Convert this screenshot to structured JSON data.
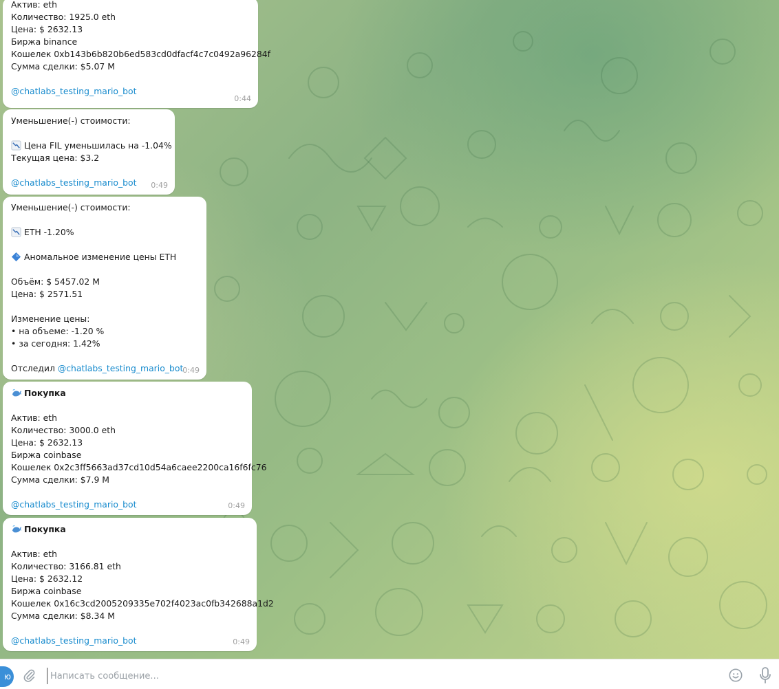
{
  "messages": [
    {
      "lines": [
        "Актив: eth",
        "Количество: 1925.0 eth",
        "Цена: $ 2632.13",
        "Биржа binance",
        "Кошелек 0xb143b6b820b6ed583cd0dfacf4c7c0492a96284f",
        "Сумма сделки: $5.07 M"
      ],
      "link": "@chatlabs_testing_mario_bot",
      "time": "0:44"
    },
    {
      "header": "Уменьшение(-) стоимости:",
      "alert_text": "Цена FIL уменьшилась на -1.04%",
      "line2": "Текущая цена: $3.2",
      "link": "@chatlabs_testing_mario_bot",
      "time": "0:49"
    },
    {
      "header": "Уменьшение(-) стоимости:",
      "alert_text": "ETH -1.20%",
      "anomaly": "Аномальное изменение цены ETH",
      "volume": "Объём: $ 5457.02 M",
      "price": "Цена: $ 2571.51",
      "change_header": "Изменение цены:",
      "change_volume": " • на объеме: -1.20 %",
      "change_today": " • за сегодня: 1.42%",
      "tracked_prefix": "Отследил ",
      "link": "@chatlabs_testing_mario_bot",
      "time": "0:49"
    },
    {
      "title": "Покупка",
      "lines": [
        "Актив: eth",
        "Количество: 3000.0 eth",
        "Цена: $ 2632.13",
        "Биржа coinbase",
        "Кошелек 0x2c3ff5663ad37cd10d54a6caee2200ca16f6fc76",
        "Сумма сделки: $7.9 M"
      ],
      "link": "@chatlabs_testing_mario_bot",
      "time": "0:49"
    },
    {
      "title": "Покупка",
      "lines": [
        "Актив: eth",
        "Количество: 3166.81 eth",
        "Цена: $ 2632.12",
        "Биржа coinbase",
        "Кошелек 0x16c3cd2005209335e702f4023ac0fb342688a1d2",
        "Сумма сделки: $8.34 M"
      ],
      "link": "@chatlabs_testing_mario_bot",
      "time": "0:49"
    }
  ],
  "composer": {
    "placeholder": "Написать сообщение...",
    "send_partial_label": "ю"
  },
  "icons": {
    "chart_down": "chart-decreasing-icon",
    "diamond": "blue-diamond-icon",
    "whale": "whale-icon",
    "attach": "paperclip-icon",
    "emoji": "smile-icon",
    "mic": "microphone-icon"
  },
  "colors": {
    "link": "#168acd",
    "time": "#a0a0a0",
    "send_button": "#3a8fd8"
  }
}
